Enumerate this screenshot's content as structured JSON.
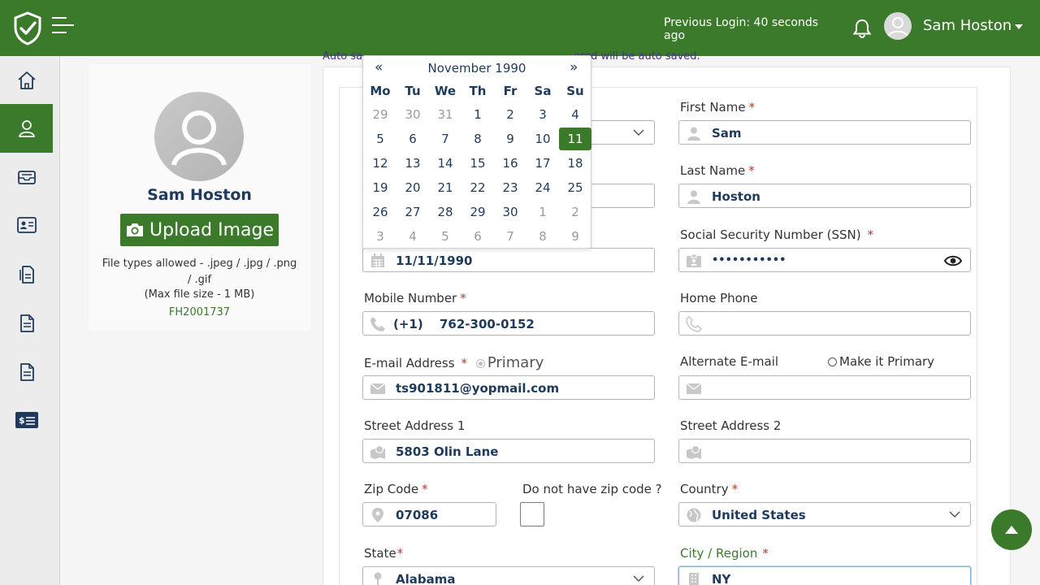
{
  "header": {
    "previous_login": "Previous Login: 40 seconds ago",
    "user_name": "Sam Hoston"
  },
  "sidebar": {
    "items": [
      {
        "name": "home-icon"
      },
      {
        "name": "user-icon",
        "active": true
      },
      {
        "name": "inbox-icon"
      },
      {
        "name": "id-card-icon"
      },
      {
        "name": "documents-icon"
      },
      {
        "name": "file-icon"
      },
      {
        "name": "file-icon"
      },
      {
        "name": "billing-icon"
      }
    ]
  },
  "profile": {
    "name": "Sam Hoston",
    "upload_label": "Upload Image",
    "file_types": "File types allowed - .jpeg / .jpg / .png / .gif",
    "max_size": "(Max file size - 1 MB)",
    "id": "FH2001737"
  },
  "autosave_left": "Auto sa",
  "autosave_right": "ered will be auto saved.",
  "calendar": {
    "prev": "«",
    "next": "»",
    "title": "November 1990",
    "weekdays": [
      "Mo",
      "Tu",
      "We",
      "Th",
      "Fr",
      "Sa",
      "Su"
    ],
    "weeks": [
      [
        "29",
        "30",
        "31",
        "1",
        "2",
        "3",
        "4"
      ],
      [
        "5",
        "6",
        "7",
        "8",
        "9",
        "10",
        "11"
      ],
      [
        "12",
        "13",
        "14",
        "15",
        "16",
        "17",
        "18"
      ],
      [
        "19",
        "20",
        "21",
        "22",
        "23",
        "24",
        "25"
      ],
      [
        "26",
        "27",
        "28",
        "29",
        "30",
        "1",
        "2"
      ],
      [
        "3",
        "4",
        "5",
        "6",
        "7",
        "8",
        "9"
      ]
    ],
    "selected": "11"
  },
  "form": {
    "first_name_label": "First Name",
    "first_name": "Sam",
    "last_name_label": "Last Name",
    "last_name": "Hoston",
    "ssn_label": "Social Security Number (SSN)",
    "ssn": "•••••••••••",
    "dob": "11/11/1990",
    "mobile_label": "Mobile Number",
    "mobile_code": "(+1)",
    "mobile": "762-300-0152",
    "home_phone_label": "Home Phone",
    "email_label": "E-mail Address",
    "primary_label": "Primary",
    "email": "ts901811@yopmail.com",
    "alt_email_label": "Alternate E-mail",
    "make_primary_label": "Make it Primary",
    "street1_label": "Street Address 1",
    "street1": "5803 Olin Lane",
    "street2_label": "Street Address 2",
    "zip_label": "Zip Code",
    "zip": "07086",
    "no_zip_label": "Do not have zip code ?",
    "country_label": "Country",
    "country": "United States",
    "state_label": "State",
    "state": "Alabama",
    "city_label": "City / Region",
    "city": "NY",
    "required_mark": "*"
  },
  "colors": {
    "brand_green": "#3a7a2a",
    "text_navy": "#1e3a5c",
    "required_red": "#c0392b"
  }
}
